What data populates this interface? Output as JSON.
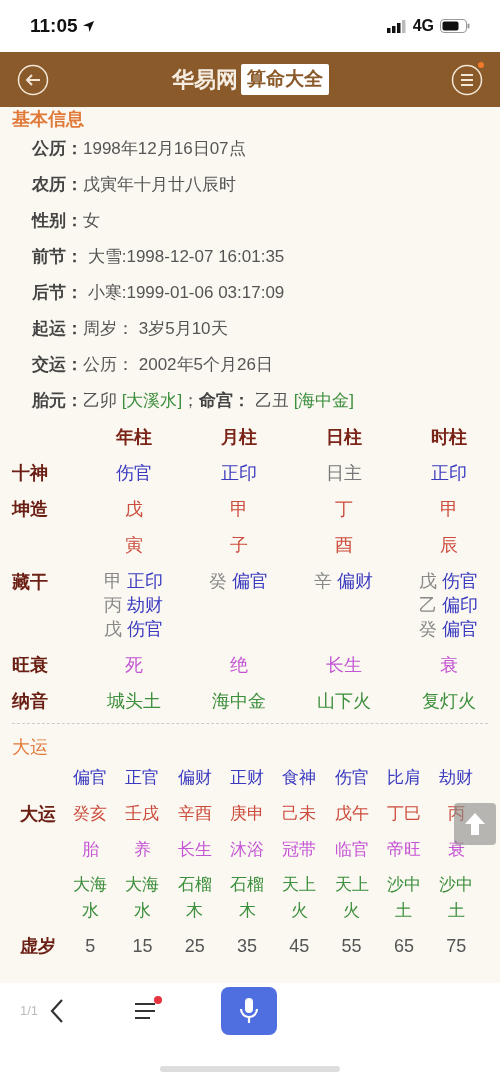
{
  "status_bar": {
    "time": "11:05",
    "network": "4G"
  },
  "header": {
    "title": "华易网",
    "badge": "算命大全",
    "menu_notification": true
  },
  "basic_info": {
    "title": "基本信息",
    "rows": [
      {
        "label": "公历：",
        "segments": [
          {
            "text": "1998年12月16日07点",
            "kind": "plain"
          }
        ]
      },
      {
        "label": "农历：",
        "segments": [
          {
            "text": "戊寅年十月廿八辰时",
            "kind": "plain"
          }
        ]
      },
      {
        "label": "性别：",
        "segments": [
          {
            "text": "女",
            "kind": "plain"
          }
        ]
      },
      {
        "label": "前节：",
        "segments": [
          {
            "text": " 大雪:1998-12-07 16:01:35",
            "kind": "plain"
          }
        ]
      },
      {
        "label": "后节：",
        "segments": [
          {
            "text": " 小寒:1999-01-06 03:17:09",
            "kind": "plain"
          }
        ]
      },
      {
        "label": "起运：",
        "segments": [
          {
            "text": "周岁： 3岁5月10天",
            "kind": "plain"
          }
        ]
      },
      {
        "label": "交运：",
        "segments": [
          {
            "text": "公历： 2002年5个月26日",
            "kind": "plain"
          }
        ]
      },
      {
        "label": "胎元：",
        "segments": [
          {
            "text": "乙卯 ",
            "kind": "plain"
          },
          {
            "text": "[大溪水]",
            "kind": "nayin"
          },
          {
            "text": "；",
            "kind": "plain"
          },
          {
            "text": "命宫：",
            "kind": "label"
          },
          {
            "text": " 乙丑 ",
            "kind": "plain"
          },
          {
            "text": "[海中金]",
            "kind": "nayin"
          }
        ]
      }
    ]
  },
  "pillars": {
    "row_labels": {
      "ten_god": "十神",
      "stem": "坤造",
      "hidden": "藏干",
      "strength": "旺衰",
      "nayin": "纳音"
    },
    "columns": [
      {
        "header": "年柱",
        "ten_god": {
          "text": "伤官",
          "kind": "god"
        },
        "stem": "戊",
        "branch": "寅",
        "hidden": [
          {
            "stem": "甲",
            "god": "正印"
          },
          {
            "stem": "丙",
            "god": "劫财"
          },
          {
            "stem": "戊",
            "god": "伤官"
          }
        ],
        "strength": "死",
        "nayin": "城头土"
      },
      {
        "header": "月柱",
        "ten_god": {
          "text": "正印",
          "kind": "god"
        },
        "stem": "甲",
        "branch": "子",
        "hidden": [
          {
            "stem": "癸",
            "god": "偏官"
          }
        ],
        "strength": "绝",
        "nayin": "海中金"
      },
      {
        "header": "日柱",
        "ten_god": {
          "text": "日主",
          "kind": "self"
        },
        "stem": "丁",
        "branch": "酉",
        "hidden": [
          {
            "stem": "辛",
            "god": "偏财"
          }
        ],
        "strength": "长生",
        "nayin": "山下火"
      },
      {
        "header": "时柱",
        "ten_god": {
          "text": "正印",
          "kind": "god"
        },
        "stem": "甲",
        "branch": "辰",
        "hidden": [
          {
            "stem": "戊",
            "god": "伤官"
          },
          {
            "stem": "乙",
            "god": "偏印"
          },
          {
            "stem": "癸",
            "god": "偏官"
          }
        ],
        "strength": "衰",
        "nayin": "复灯火"
      }
    ]
  },
  "dayun": {
    "title": "大运",
    "row_label": "大运",
    "age_label": "虚岁",
    "columns": [
      {
        "god": "偏官",
        "pillar": "癸亥",
        "stage": "胎",
        "nayin": "大海水",
        "age": "5"
      },
      {
        "god": "正官",
        "pillar": "壬戌",
        "stage": "养",
        "nayin": "大海水",
        "age": "15"
      },
      {
        "god": "偏财",
        "pillar": "辛酉",
        "stage": "长生",
        "nayin": "石榴木",
        "age": "25"
      },
      {
        "god": "正财",
        "pillar": "庚申",
        "stage": "沐浴",
        "nayin": "石榴木",
        "age": "35"
      },
      {
        "god": "食神",
        "pillar": "己未",
        "stage": "冠带",
        "nayin": "天上火",
        "age": "45"
      },
      {
        "god": "伤官",
        "pillar": "戊午",
        "stage": "临官",
        "nayin": "天上火",
        "age": "55"
      },
      {
        "god": "比肩",
        "pillar": "丁巳",
        "stage": "帝旺",
        "nayin": "沙中土",
        "age": "65"
      },
      {
        "god": "劫财",
        "pillar": "丙",
        "stage": "衰",
        "nayin": "沙中土",
        "age": "75"
      }
    ]
  },
  "toolbar": {
    "page": "1/1",
    "menu_notification": true
  }
}
